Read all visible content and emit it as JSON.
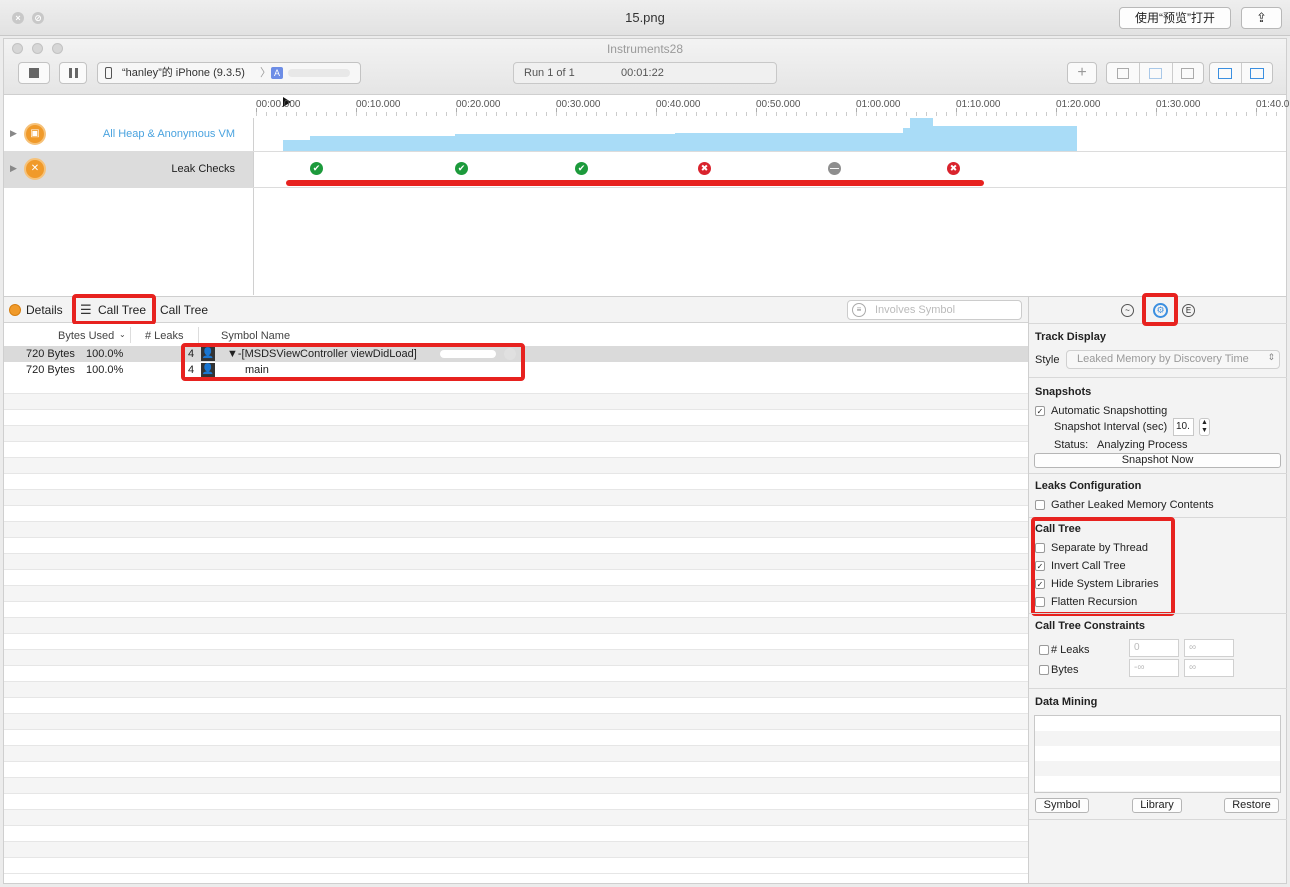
{
  "preview": {
    "title": "15.png",
    "open_button": "使用“预览”打开",
    "share_icon": "share-icon"
  },
  "window": {
    "title": "Instruments28",
    "device": "“hanley”的 iPhone (9.3.5)",
    "run_label": "Run 1 of 1",
    "elapsed": "00:01:22"
  },
  "ruler": {
    "ticks": [
      "00:00.000",
      "00:10.000",
      "00:20.000",
      "00:30.000",
      "00:40.000",
      "00:50.000",
      "01:00.000",
      "01:10.000",
      "01:20.000",
      "01:30.000",
      "01:40.0"
    ]
  },
  "tracks": [
    {
      "label": "All Heap & Anonymous VM",
      "color": "#4aa3df"
    },
    {
      "label": "Leak Checks",
      "color": "#222222"
    }
  ],
  "leak_checks": [
    {
      "status": "ok",
      "symbol": "✔"
    },
    {
      "status": "ok",
      "symbol": "✔"
    },
    {
      "status": "ok",
      "symbol": "✔"
    },
    {
      "status": "leak",
      "symbol": "✖"
    },
    {
      "status": "none",
      "symbol": "—"
    },
    {
      "status": "leak",
      "symbol": "✖"
    }
  ],
  "detail": {
    "crumb_details": "Details",
    "crumb_calltree": "Call Tree",
    "crumb_calltree2": "Call Tree",
    "search_placeholder": "Involves Symbol",
    "columns": {
      "bytes_used": "Bytes Used",
      "leaks": "# Leaks",
      "symbol": "Symbol Name"
    },
    "rows": [
      {
        "bytes": "720 Bytes",
        "percent": "100.0%",
        "leaks": "4",
        "symbol": "▼-[MSDSViewController viewDidLoad]"
      },
      {
        "bytes": "720 Bytes",
        "percent": "100.0%",
        "leaks": "4",
        "symbol": "main"
      }
    ]
  },
  "inspector": {
    "track_display": "Track Display",
    "style_label": "Style",
    "style_value": "Leaked Memory by Discovery Time",
    "snapshots": "Snapshots",
    "auto_snapshot": "Automatic Snapshotting",
    "interval_label": "Snapshot Interval (sec)",
    "interval_value": "10.",
    "status_label": "Status:",
    "status_value": "Analyzing Process",
    "snapshot_now": "Snapshot Now",
    "leaks_config": "Leaks Configuration",
    "gather_contents": "Gather Leaked Memory Contents",
    "call_tree": "Call Tree",
    "separate_thread": "Separate by Thread",
    "invert_call_tree": "Invert Call Tree",
    "hide_system": "Hide System Libraries",
    "flatten_recursion": "Flatten Recursion",
    "constraints": "Call Tree Constraints",
    "leaks_constraint": "# Leaks",
    "bytes_constraint": "Bytes",
    "leaks_min": "0",
    "leaks_max": "∞",
    "bytes_min": "-∞",
    "bytes_max": "∞",
    "data_mining": "Data Mining",
    "symbol_btn": "Symbol",
    "library_btn": "Library",
    "restore_btn": "Restore",
    "checked": {
      "auto_snapshot": true,
      "gather_contents": false,
      "separate_thread": false,
      "invert_call_tree": true,
      "hide_system": true,
      "flatten_recursion": false,
      "leaks_constraint": false,
      "bytes_constraint": false
    }
  },
  "colors": {
    "annotation_red": "#e7221f",
    "heap_fill": "#a9dcf7",
    "leak_ok": "#1c9a3c",
    "leak_bad": "#d9232d",
    "leak_none": "#8e8e8e"
  }
}
